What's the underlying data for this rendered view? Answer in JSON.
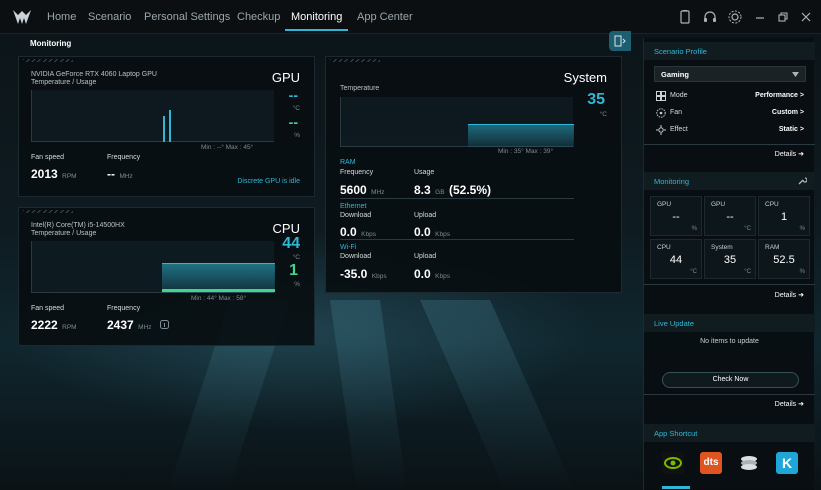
{
  "nav": {
    "tabs": [
      "Home",
      "Scenario",
      "Personal Settings",
      "Checkup",
      "Monitoring",
      "App Center"
    ],
    "active_tab": "Monitoring"
  },
  "page_title": "Monitoring",
  "gpu": {
    "model": "NVIDIA GeForce RTX 4060 Laptop GPU",
    "subtitle": "Temperature / Usage",
    "heading": "GPU",
    "temp_value": "--",
    "temp_unit": "°C",
    "usage_value": "--",
    "usage_unit": "%",
    "minmax": "Min : --°   Max : 45°",
    "fan_label": "Fan speed",
    "fan_value": "2013",
    "fan_unit": "RPM",
    "freq_label": "Frequency",
    "freq_value": "--",
    "freq_unit": "MHz",
    "idle_text": "Discrete GPU is idle"
  },
  "cpu": {
    "model": "Intel(R) Core(TM) i5-14500HX",
    "subtitle": "Temperature / Usage",
    "heading": "CPU",
    "temp_value": "44",
    "temp_unit": "°C",
    "usage_value": "1",
    "usage_unit": "%",
    "minmax": "Min : 44°   Max : 58°",
    "fan_label": "Fan speed",
    "fan_value": "2222",
    "fan_unit": "RPM",
    "freq_label": "Frequency",
    "freq_value": "2437",
    "freq_unit": "MHz"
  },
  "system": {
    "heading": "System",
    "temp_label": "Temperature",
    "temp_value": "35",
    "temp_unit": "°C",
    "minmax": "Min : 35°   Max : 39°",
    "ram_title": "RAM",
    "ram_freq_label": "Frequency",
    "ram_freq_value": "5600",
    "ram_freq_unit": "MHz",
    "ram_usage_label": "Usage",
    "ram_usage_value": "8.3",
    "ram_usage_unit": "GB",
    "ram_usage_pct": "(52.5%)",
    "eth_title": "Ethernet",
    "eth_down_label": "Download",
    "eth_down_value": "0.0",
    "eth_down_unit": "Kbps",
    "eth_up_label": "Upload",
    "eth_up_value": "0.0",
    "eth_up_unit": "Kbps",
    "wifi_title": "Wi-Fi",
    "wifi_down_label": "Download",
    "wifi_down_value": "-35.0",
    "wifi_down_unit": "Kbps",
    "wifi_up_label": "Upload",
    "wifi_up_value": "0.0",
    "wifi_up_unit": "Kbps"
  },
  "sidebar": {
    "scenario_title": "Scenario Profile",
    "profile_selected": "Gaming",
    "mode_label": "Mode",
    "mode_value": "Performance >",
    "fan_label": "Fan",
    "fan_value": "Custom >",
    "effect_label": "Effect",
    "effect_value": "Static >",
    "details": "Details",
    "monitoring_title": "Monitoring",
    "tiles": [
      {
        "t": "GPU",
        "v": "--",
        "u": "%"
      },
      {
        "t": "GPU",
        "v": "--",
        "u": "°C"
      },
      {
        "t": "CPU",
        "v": "1",
        "u": "%"
      },
      {
        "t": "CPU",
        "v": "44",
        "u": "°C"
      },
      {
        "t": "System",
        "v": "35",
        "u": "°C"
      },
      {
        "t": "RAM",
        "v": "52.5",
        "u": "%"
      }
    ],
    "live_title": "Live Update",
    "live_msg": "No items to update",
    "check_now": "Check Now",
    "shortcut_title": "App Shortcut",
    "dts_text": "dts",
    "k_text": "K"
  },
  "colors": {
    "accent": "#2fb8d6",
    "gpu_usage": "#3fd58a"
  }
}
